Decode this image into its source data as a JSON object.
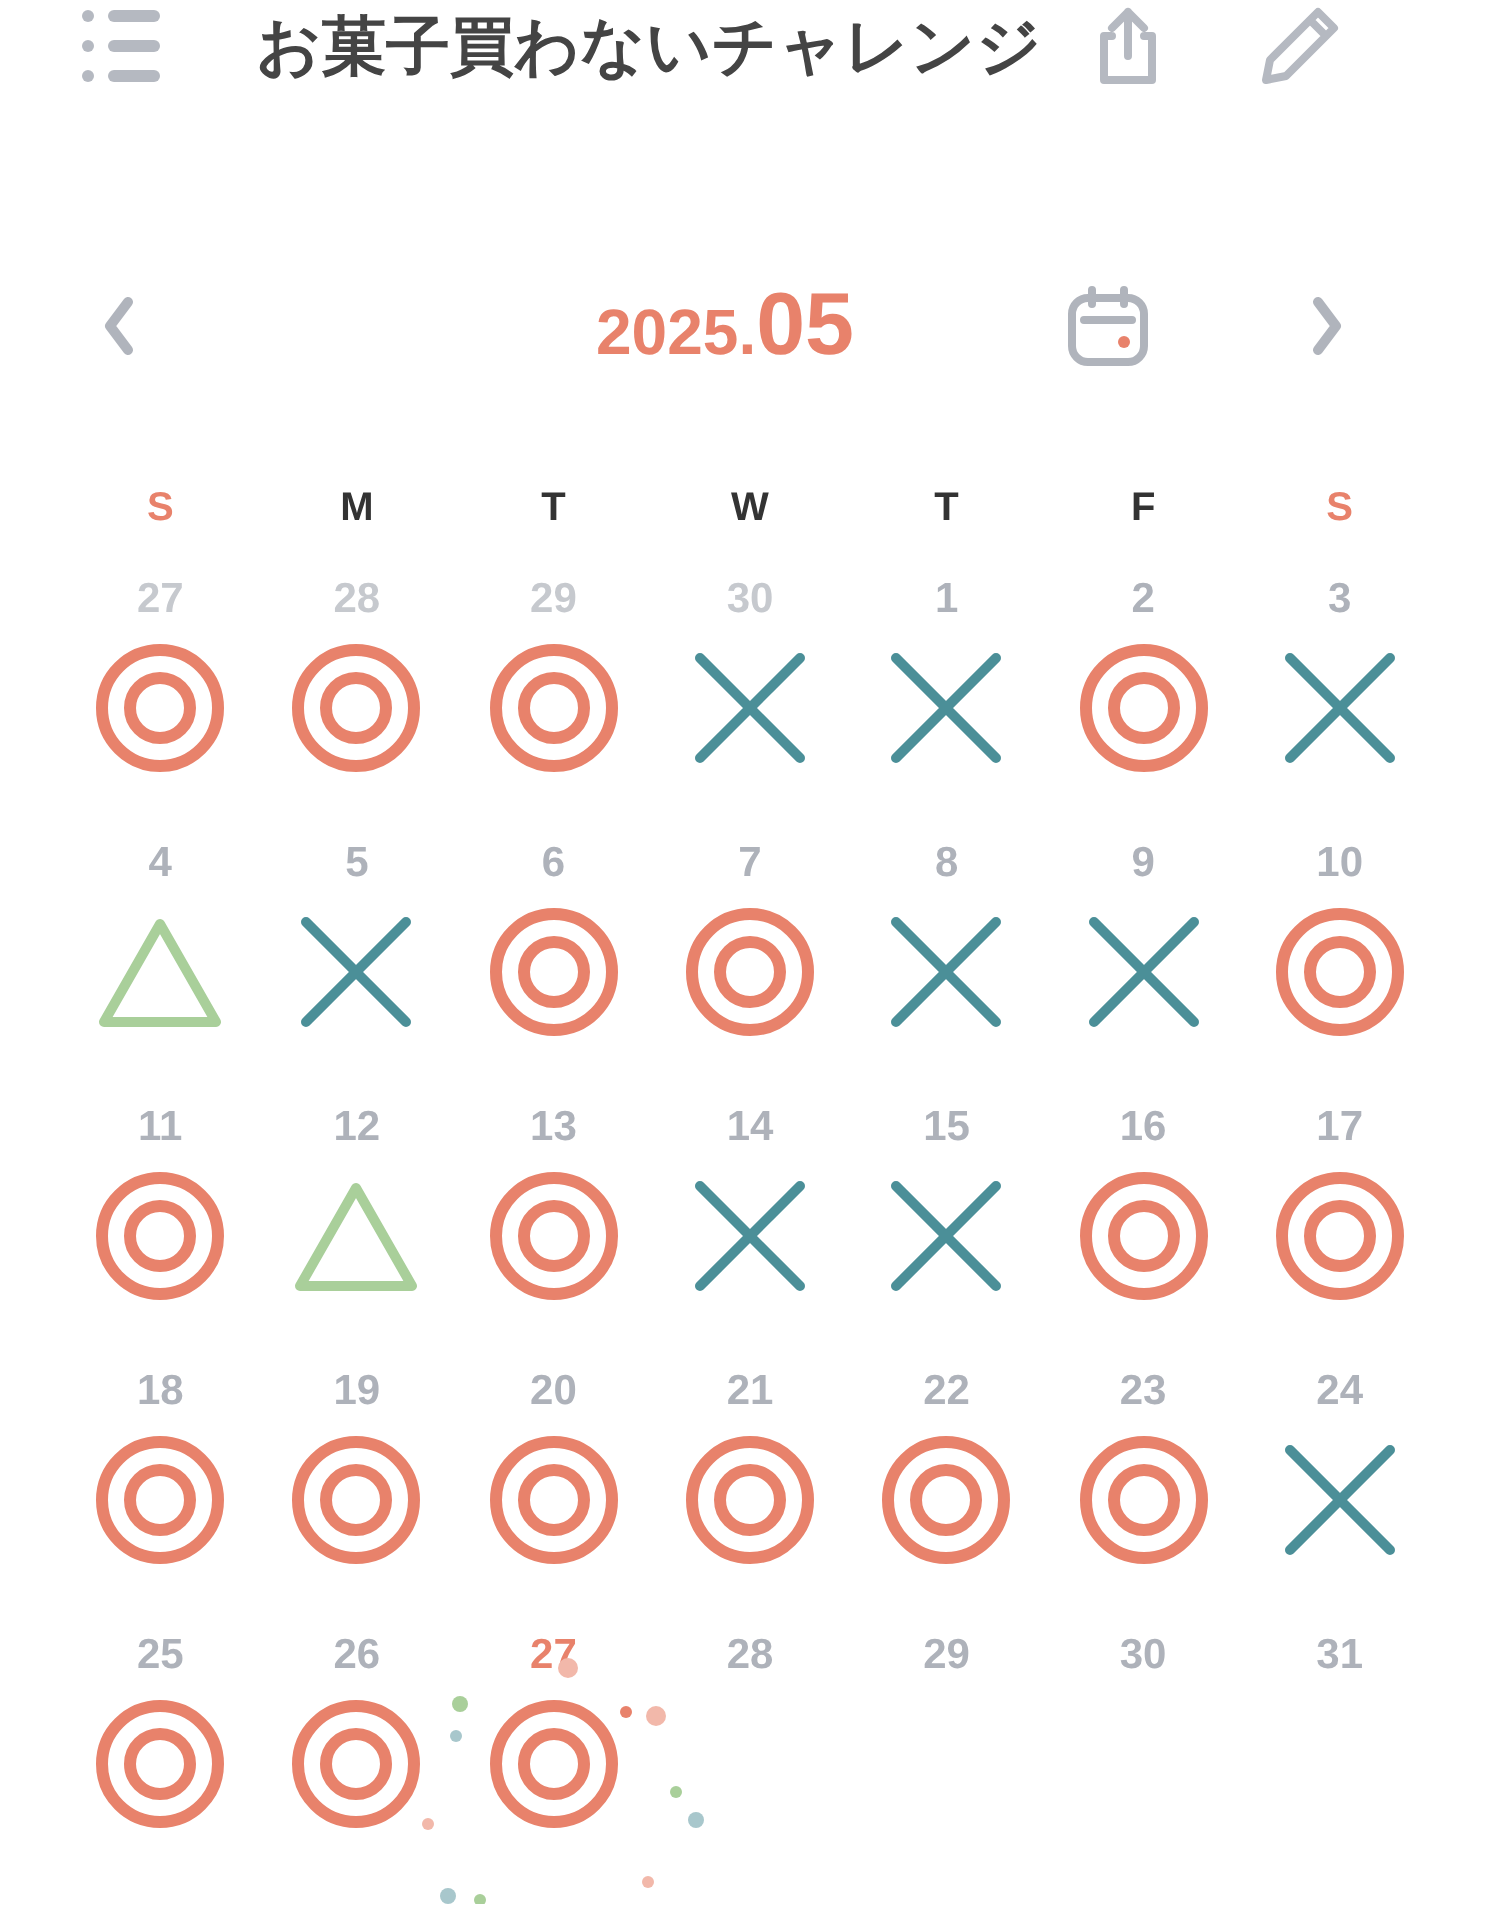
{
  "title": "お菓子買わないチャレンジ",
  "month": {
    "year": "2025.",
    "month": "05"
  },
  "weekdays": [
    {
      "label": "S",
      "weekend": true
    },
    {
      "label": "M",
      "weekend": false
    },
    {
      "label": "T",
      "weekend": false
    },
    {
      "label": "W",
      "weekend": false
    },
    {
      "label": "T",
      "weekend": false
    },
    {
      "label": "F",
      "weekend": false
    },
    {
      "label": "S",
      "weekend": true
    }
  ],
  "days": [
    {
      "label": "27",
      "other_month": true,
      "selected": false,
      "kind": "circle"
    },
    {
      "label": "28",
      "other_month": true,
      "selected": false,
      "kind": "circle"
    },
    {
      "label": "29",
      "other_month": true,
      "selected": false,
      "kind": "circle"
    },
    {
      "label": "30",
      "other_month": true,
      "selected": false,
      "kind": "cross"
    },
    {
      "label": "1",
      "other_month": false,
      "selected": false,
      "kind": "cross"
    },
    {
      "label": "2",
      "other_month": false,
      "selected": false,
      "kind": "circle"
    },
    {
      "label": "3",
      "other_month": false,
      "selected": false,
      "kind": "cross"
    },
    {
      "label": "4",
      "other_month": false,
      "selected": false,
      "kind": "triangle"
    },
    {
      "label": "5",
      "other_month": false,
      "selected": false,
      "kind": "cross"
    },
    {
      "label": "6",
      "other_month": false,
      "selected": false,
      "kind": "circle"
    },
    {
      "label": "7",
      "other_month": false,
      "selected": false,
      "kind": "circle"
    },
    {
      "label": "8",
      "other_month": false,
      "selected": false,
      "kind": "cross"
    },
    {
      "label": "9",
      "other_month": false,
      "selected": false,
      "kind": "cross"
    },
    {
      "label": "10",
      "other_month": false,
      "selected": false,
      "kind": "circle"
    },
    {
      "label": "11",
      "other_month": false,
      "selected": false,
      "kind": "circle"
    },
    {
      "label": "12",
      "other_month": false,
      "selected": false,
      "kind": "triangle"
    },
    {
      "label": "13",
      "other_month": false,
      "selected": false,
      "kind": "circle"
    },
    {
      "label": "14",
      "other_month": false,
      "selected": false,
      "kind": "cross"
    },
    {
      "label": "15",
      "other_month": false,
      "selected": false,
      "kind": "cross"
    },
    {
      "label": "16",
      "other_month": false,
      "selected": false,
      "kind": "circle"
    },
    {
      "label": "17",
      "other_month": false,
      "selected": false,
      "kind": "circle"
    },
    {
      "label": "18",
      "other_month": false,
      "selected": false,
      "kind": "circle"
    },
    {
      "label": "19",
      "other_month": false,
      "selected": false,
      "kind": "circle"
    },
    {
      "label": "20",
      "other_month": false,
      "selected": false,
      "kind": "circle"
    },
    {
      "label": "21",
      "other_month": false,
      "selected": false,
      "kind": "circle"
    },
    {
      "label": "22",
      "other_month": false,
      "selected": false,
      "kind": "circle"
    },
    {
      "label": "23",
      "other_month": false,
      "selected": false,
      "kind": "circle"
    },
    {
      "label": "24",
      "other_month": false,
      "selected": false,
      "kind": "cross"
    },
    {
      "label": "25",
      "other_month": false,
      "selected": false,
      "kind": "circle"
    },
    {
      "label": "26",
      "other_month": false,
      "selected": false,
      "kind": "circle"
    },
    {
      "label": "27",
      "other_month": false,
      "selected": true,
      "kind": "circle"
    },
    {
      "label": "28",
      "other_month": false,
      "selected": false,
      "kind": "none"
    },
    {
      "label": "29",
      "other_month": false,
      "selected": false,
      "kind": "none"
    },
    {
      "label": "30",
      "other_month": false,
      "selected": false,
      "kind": "none"
    },
    {
      "label": "31",
      "other_month": false,
      "selected": false,
      "kind": "none"
    }
  ]
}
